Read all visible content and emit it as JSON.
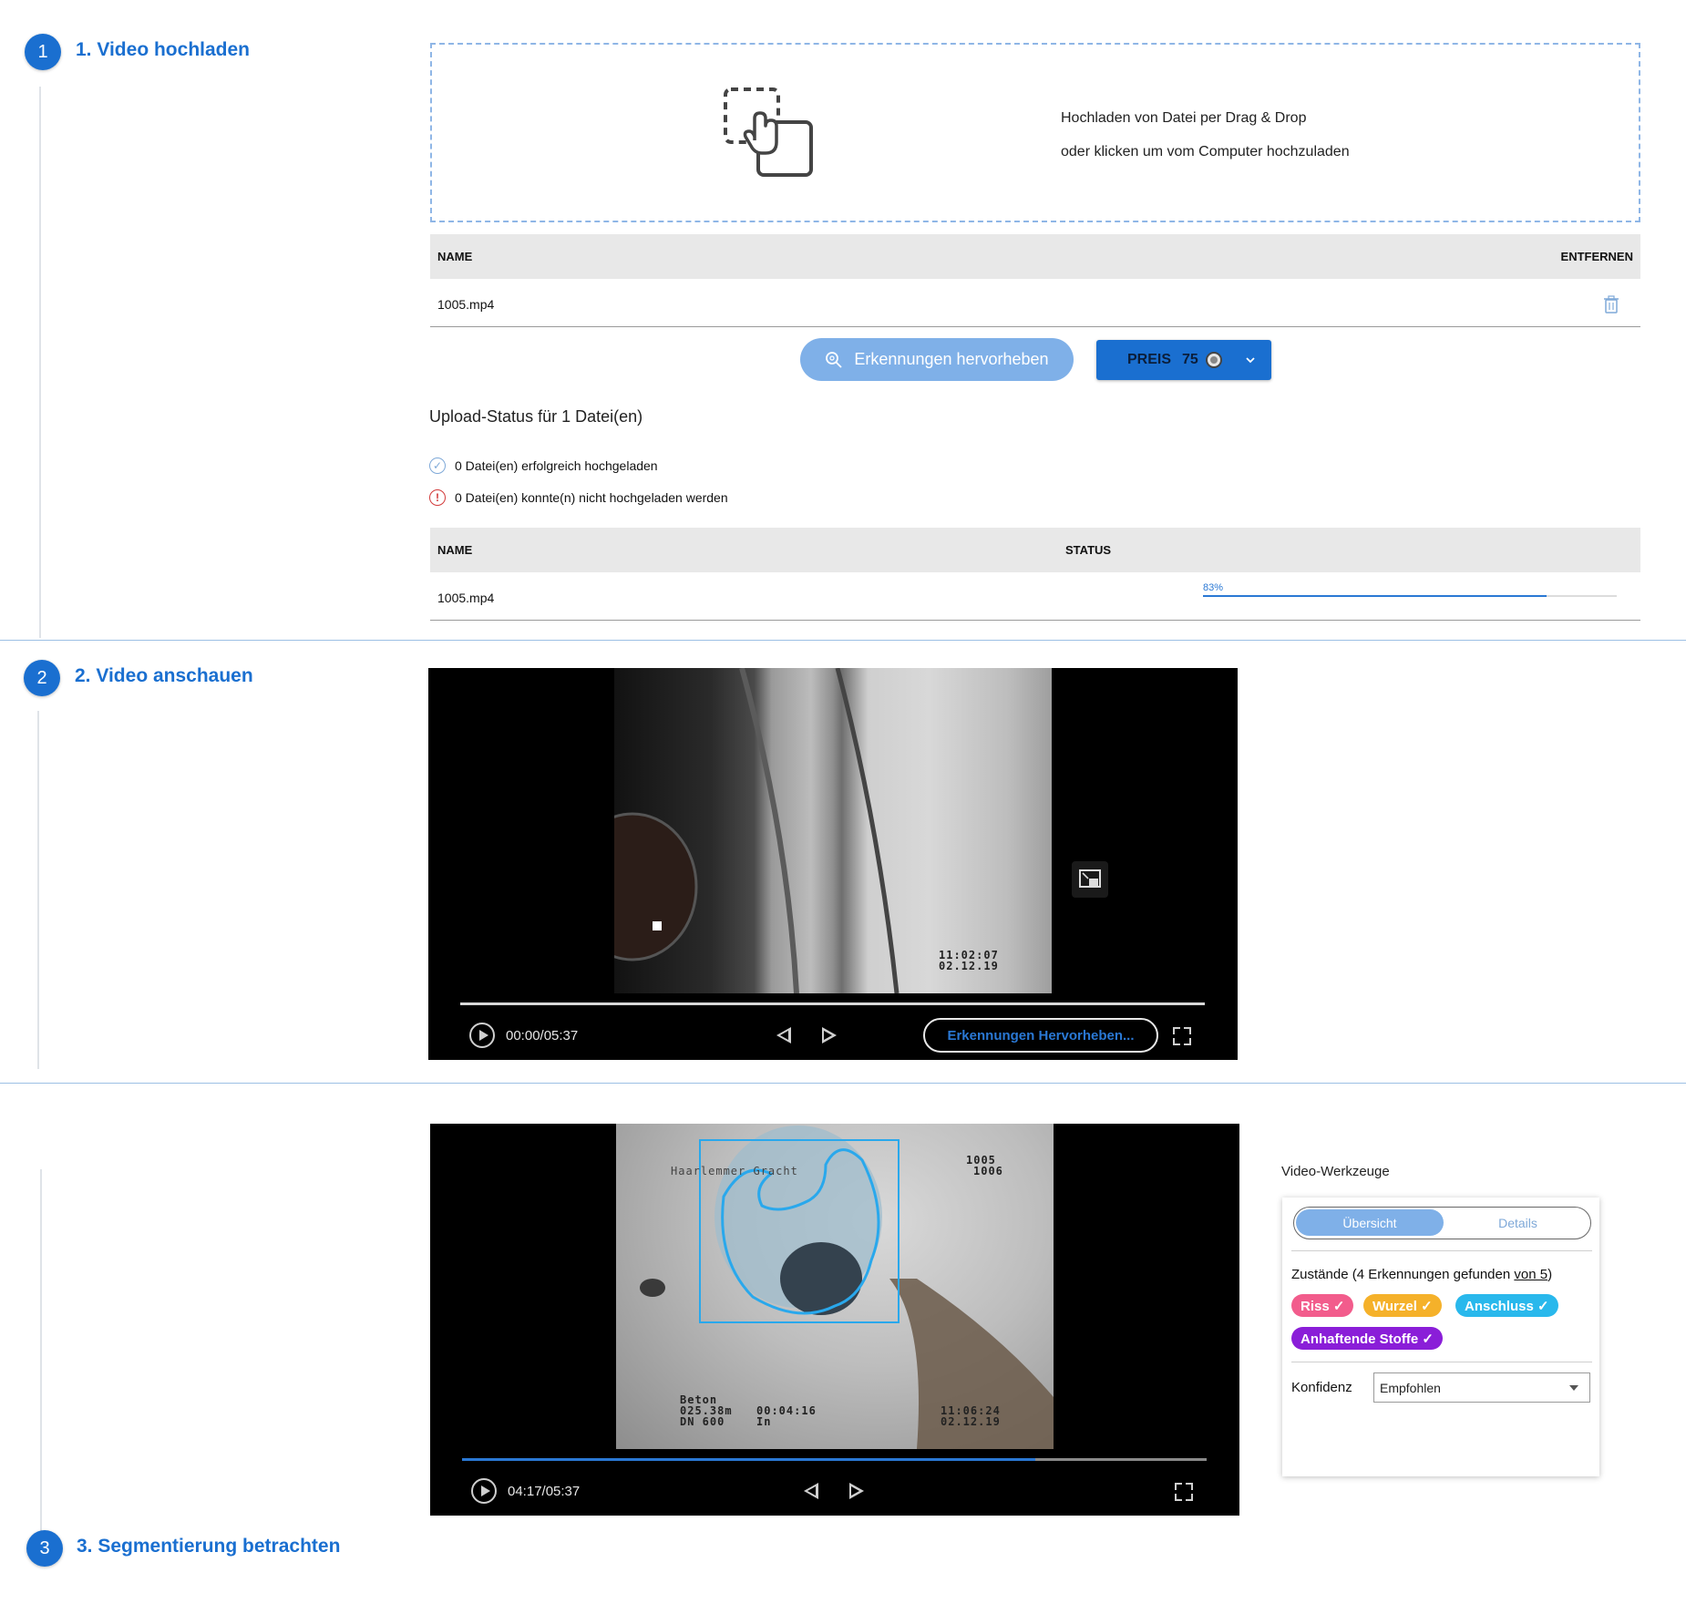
{
  "steps": [
    {
      "number": "1",
      "title": "1. Video hochladen"
    },
    {
      "number": "2",
      "title": "2. Video anschauen"
    },
    {
      "number": "3",
      "title": "3. Segmentierung betrachten"
    }
  ],
  "upload": {
    "drop_line1": "Hochladen von Datei per Drag & Drop",
    "drop_line2": "oder klicken um vom Computer hochzuladen",
    "files_table": {
      "col_name": "NAME",
      "col_remove": "ENTFERNEN",
      "rows": [
        {
          "name": "1005.mp4"
        }
      ]
    },
    "highlight_button": "Erkennungen hervorheben",
    "price_label": "PREIS",
    "price_value": "75",
    "status_title": "Upload-Status für 1 Datei(en)",
    "success_text": "0 Datei(en) erfolgreich hochgeladen",
    "failure_text": "0 Datei(en) konnte(n) nicht hochgeladen werden",
    "status_table": {
      "col_name": "NAME",
      "col_status": "STATUS",
      "rows": [
        {
          "name": "1005.mp4",
          "progress_label": "83%",
          "progress": 0.83
        }
      ]
    }
  },
  "player1": {
    "overlay_time": "11:02:07",
    "overlay_date": "02.12.19",
    "time": "00:00/05:37",
    "highlight_button": "Erkennungen Hervorheben...",
    "progress": 0.0
  },
  "player2": {
    "overlay_street": "Haarlemmer Gracht",
    "overlay_id1": "1005",
    "overlay_id2": "1006",
    "overlay_material": "Beton",
    "overlay_distance": "025.38m",
    "overlay_clock": "00:04:16",
    "overlay_dn": "DN 600",
    "overlay_dir": "In",
    "overlay_time": "11:06:24",
    "overlay_date": "02.12.19",
    "time": "04:17/05:37",
    "progress": 0.77
  },
  "tools": {
    "title": "Video-Werkzeuge",
    "tab_overview": "Übersicht",
    "tab_details": "Details",
    "conditions_prefix": "Zustände (4 Erkennungen gefunden ",
    "conditions_link": "von 5",
    "conditions_suffix": ")",
    "tags": [
      {
        "label": "Riss ✓",
        "color": "#f25c8c"
      },
      {
        "label": "Wurzel ✓",
        "color": "#f5b12a"
      },
      {
        "label": "Anschluss ✓",
        "color": "#29b8ec"
      },
      {
        "label": "Anhaftende Stoffe ✓",
        "color": "#8a1ed8"
      }
    ],
    "confidence_label": "Konfidenz",
    "confidence_value": "Empfohlen"
  }
}
